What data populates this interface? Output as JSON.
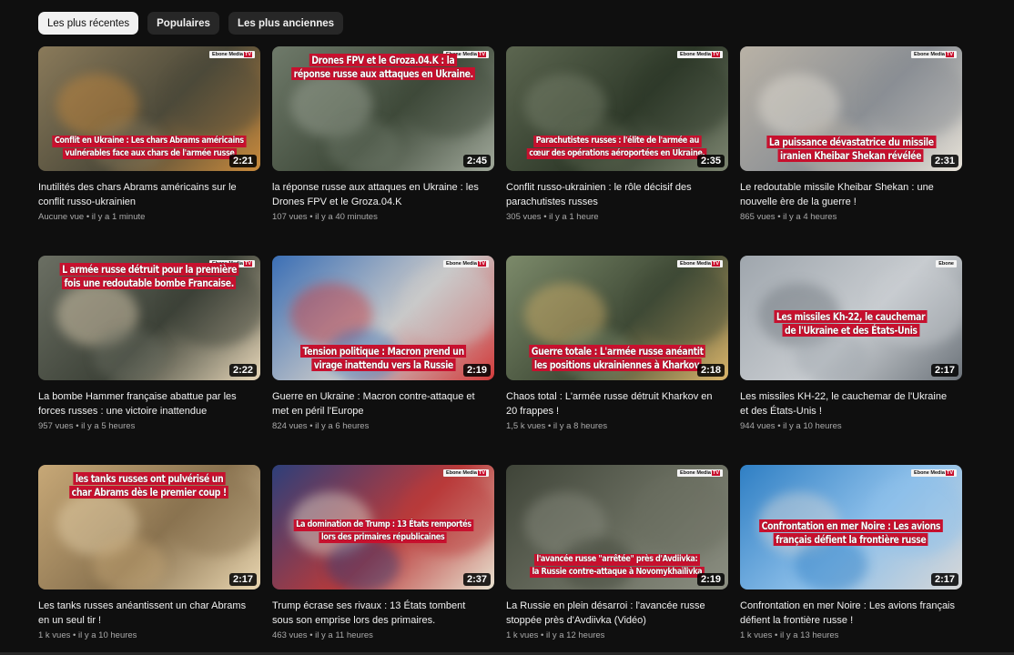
{
  "filters": [
    {
      "label": "Les plus récentes",
      "active": true
    },
    {
      "label": "Populaires",
      "active": false
    },
    {
      "label": "Les plus anciennes",
      "active": false
    }
  ],
  "videos": [
    {
      "caption": [
        "Conflit en Ukraine : Les chars Abrams américains",
        "vulnérables face aux chars de l'armée russe"
      ],
      "caption_pos": "bottom",
      "logo": "Ebone Media",
      "logo_tag": "TV",
      "duration": "2:21",
      "title": "Inutilités des chars Abrams américains sur le conflit russo-ukrainien",
      "views": "Aucune vue",
      "age": "il y a 1 minute",
      "palette": [
        "#8a7a5a",
        "#4d4a3a",
        "#c98a3c"
      ]
    },
    {
      "caption": [
        "Drones FPV et le Groza.04.K : la",
        "réponse russe aux attaques en Ukraine."
      ],
      "caption_pos": "top",
      "logo": "Ebone Media",
      "logo_tag": "TV",
      "duration": "2:45",
      "title": "la réponse russe aux attaques en Ukraine : les Drones FPV et le Groza.04.K",
      "views": "107 vues",
      "age": "il y a 40 minutes",
      "palette": [
        "#6f7a6a",
        "#3f4a3a",
        "#a0a89a"
      ]
    },
    {
      "caption": [
        "Parachutistes russes : l'élite de l'armée au",
        "cœur des opérations aéroportées en Ukraine."
      ],
      "caption_pos": "bottom",
      "logo": "Ebone Media",
      "logo_tag": "TV",
      "duration": "2:35",
      "title": "Conflit russo-ukrainien : le rôle décisif des parachutistes russes",
      "views": "305 vues",
      "age": "il y a 1 heure",
      "palette": [
        "#5c6650",
        "#2f3a2a",
        "#7c8570"
      ]
    },
    {
      "caption": [
        "La puissance dévastatrice du missile",
        "iranien Kheibar Shekan révélée"
      ],
      "caption_pos": "bottom",
      "logo": "Ebone Media",
      "logo_tag": "TV",
      "duration": "2:31",
      "title": "Le redoutable missile Kheibar Shekan : une nouvelle ère de la guerre !",
      "views": "865 vues",
      "age": "il y a 4 heures",
      "palette": [
        "#b9b2a6",
        "#8b8f94",
        "#e7e2d8"
      ]
    },
    {
      "caption": [
        "L armée russe détruit pour la première",
        "fois une redoutable bombe Francaise."
      ],
      "caption_pos": "top",
      "logo": "Ebone Media",
      "logo_tag": "TV",
      "duration": "2:22",
      "title": "La bombe Hammer française abattue par les forces russes : une victoire inattendue",
      "views": "957 vues",
      "age": "il y a 5 heures",
      "palette": [
        "#6b6f63",
        "#3d4238",
        "#e6d6b8"
      ]
    },
    {
      "caption": [
        "Tension politique : Macron prend un",
        "virage inattendu vers la Russie"
      ],
      "caption_pos": "bottom",
      "logo": "Ebone Media",
      "logo_tag": "TV",
      "duration": "2:19",
      "title": "Guerre en Ukraine : Macron contre-attaque et met en péril l'Europe",
      "views": "824 vues",
      "age": "il y a 6 heures",
      "palette": [
        "#3b6fb5",
        "#c9c9c9",
        "#d23b3b"
      ]
    },
    {
      "caption": [
        "Guerre totale : L'armée russe anéantit",
        "les positions ukrainiennes à Kharkov"
      ],
      "caption_pos": "bottom",
      "logo": "Ebone Media",
      "logo_tag": "TV",
      "duration": "2:18",
      "title": "Chaos total : L'armée russe détruit Kharkov en 20 frappes !",
      "views": "1,5 k vues",
      "age": "il y a 8 heures",
      "palette": [
        "#7c8a6a",
        "#3f4a36",
        "#d9b46a"
      ]
    },
    {
      "caption": [
        "Les missiles Kh-22, le cauchemar",
        "de l'Ukraine et des États-Unis"
      ],
      "caption_pos": "middle",
      "logo": "Ebone",
      "logo_tag": "",
      "duration": "2:17",
      "title": "Les missiles KH-22, le cauchemar de l'Ukraine et des États-Unis !",
      "views": "944 vues",
      "age": "il y a 10 heures",
      "palette": [
        "#9fa6ad",
        "#c8ccd0",
        "#6d747b"
      ]
    },
    {
      "caption": [
        "les tanks russes ont pulvérisé un",
        "char Abrams dès le premier coup !"
      ],
      "caption_pos": "top",
      "logo": "",
      "logo_tag": "",
      "duration": "2:17",
      "title": "Les tanks russes anéantissent un char Abrams en un seul tir !",
      "views": "1 k vues",
      "age": "il y a 10 heures",
      "palette": [
        "#c7a877",
        "#8a7350",
        "#e9d6b0"
      ]
    },
    {
      "caption": [
        "La domination de Trump : 13 États remportés",
        "lors des primaires républicaines"
      ],
      "caption_pos": "middle",
      "logo": "Ebone Media",
      "logo_tag": "TV",
      "duration": "2:37",
      "title": "Trump écrase ses rivaux : 13 États tombent sous son emprise lors des primaires.",
      "views": "463 vues",
      "age": "il y a 11 heures",
      "palette": [
        "#2d3f7a",
        "#b93a3a",
        "#e8e1cf"
      ]
    },
    {
      "caption": [
        "l'avancée russe \"arrêtée\" près d'Avdiivka:",
        "la Russie contre-attaque à Novomykhaïlivka"
      ],
      "caption_pos": "bottom",
      "logo": "Ebone Media",
      "logo_tag": "TV",
      "duration": "2:19",
      "title": "La Russie en plein désarroi : l'avancée russe stoppée près d'Avdiivka (Vidéo)",
      "views": "1 k vues",
      "age": "il y a 12 heures",
      "palette": [
        "#3f4438",
        "#6a6e60",
        "#8c8f82"
      ]
    },
    {
      "caption": [
        "Confrontation en mer Noire : Les avions",
        "français défient la frontière russe"
      ],
      "caption_pos": "middle",
      "logo": "Ebone Media",
      "logo_tag": "TV",
      "duration": "2:17",
      "title": "Confrontation en mer Noire : Les avions français défient la frontière russe !",
      "views": "1 k vues",
      "age": "il y a 13 heures",
      "palette": [
        "#2f7fc4",
        "#8ec0ea",
        "#d7d7d7"
      ]
    }
  ]
}
